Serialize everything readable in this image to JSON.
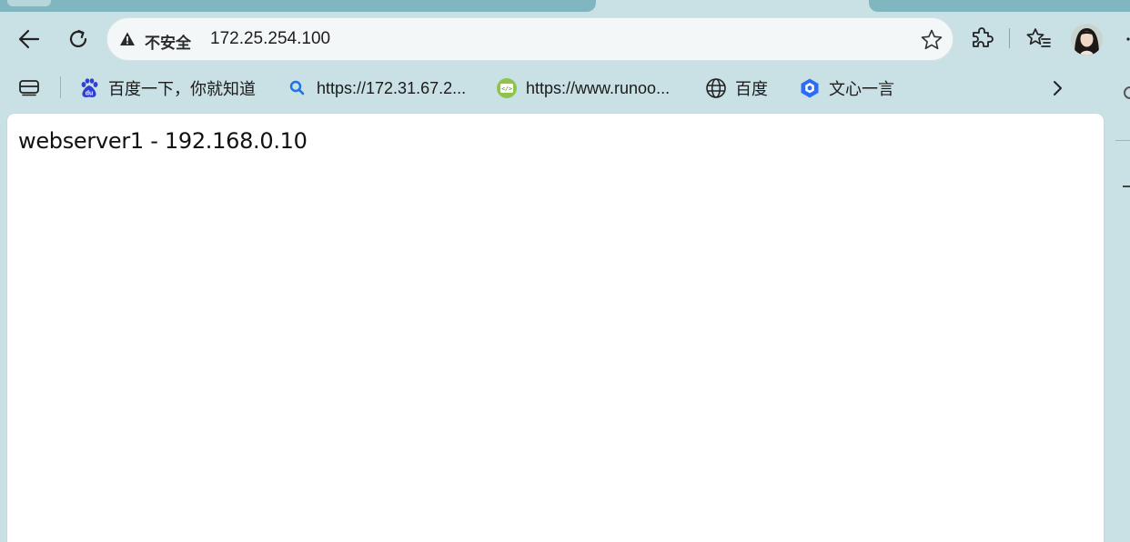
{
  "toolbar": {
    "security_label": "不安全",
    "url": "172.25.254.100"
  },
  "bookmarks": [
    {
      "label": "百度一下，你就知道",
      "icon": "baidu-paw-icon"
    },
    {
      "label": "https://172.31.67.2...",
      "icon": "search-icon"
    },
    {
      "label": "https://www.runoo...",
      "icon": "code-tag-icon"
    },
    {
      "label": "百度",
      "icon": "globe-icon"
    },
    {
      "label": "文心一言",
      "icon": "ernie-cube-icon"
    }
  ],
  "page": {
    "body_text": "webserver1 - 192.168.0.10"
  },
  "colors": {
    "chrome_bg": "#c9e0e4",
    "tab_active": "#7fb6bf",
    "page_bg": "#ffffff"
  }
}
